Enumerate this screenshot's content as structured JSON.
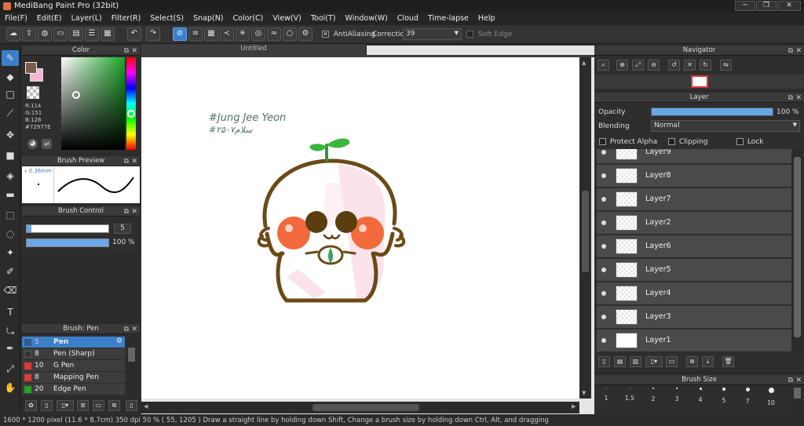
{
  "window": {
    "title": "MediBang Paint Pro (32bit)",
    "min": "─",
    "max": "❐",
    "close": "✕"
  },
  "menu": [
    "File(F)",
    "Edit(E)",
    "Layer(L)",
    "Filter(R)",
    "Select(S)",
    "Snap(N)",
    "Color(C)",
    "View(V)",
    "Tool(T)",
    "Window(W)",
    "Cloud",
    "Time-lapse",
    "Help"
  ],
  "toolbar": {
    "antialiasing_label": "AntiAliasing",
    "correction_label": "Correction",
    "correction_value": "39",
    "soft_edge_label": "Soft Edge"
  },
  "color_panel": {
    "title": "Color",
    "r": "R:114",
    "g": "G:151",
    "b": "B:126",
    "hex": "#72977E",
    "fg": "#7a5c4e",
    "bg": "#f2b8d0"
  },
  "brush_preview": {
    "title": "Brush Preview",
    "size": "0.36mm"
  },
  "brush_control": {
    "title": "Brush Control",
    "size_value": "5",
    "opacity_value": "100 %"
  },
  "brush_list": {
    "title": "Brush: Pen",
    "items": [
      {
        "size": "5",
        "name": "Pen",
        "color": "#2b5d8c",
        "selected": true
      },
      {
        "size": "8",
        "name": "Pen (Sharp)",
        "color": "#333333",
        "selected": false
      },
      {
        "size": "10",
        "name": "G Pen",
        "color": "#d93b3b",
        "selected": false
      },
      {
        "size": "8",
        "name": "Mapping Pen",
        "color": "#d93b3b",
        "selected": false
      },
      {
        "size": "20",
        "name": "Edge Pen",
        "color": "#2aa02a",
        "selected": false
      }
    ]
  },
  "document": {
    "tab": "Untitled",
    "sign_line1": "#Jung Jee Yeon",
    "sign_line2": "#سلام۲۵۰۷"
  },
  "navigator": {
    "title": "Navigator"
  },
  "layer_panel": {
    "title": "Layer",
    "opacity_label": "Opacity",
    "opacity_value": "100 %",
    "opacity": 1.0,
    "blending_label": "Blending",
    "blending_value": "Normal",
    "protect_alpha": "Protect Alpha",
    "clipping": "Clipping",
    "lock": "Lock",
    "layers": [
      "Layer9",
      "Layer8",
      "Layer7",
      "Layer2",
      "Layer6",
      "Layer5",
      "Layer4",
      "Layer3",
      "Layer1"
    ]
  },
  "brush_size": {
    "title": "Brush Size",
    "sizes": [
      "1",
      "1.5",
      "2",
      "3",
      "4",
      "5",
      "7",
      "10"
    ]
  },
  "status": {
    "text": "1600 * 1200 pixel   (11.6 * 8.7cm)  350 dpi   50 %   ( 55, 1205 )   Draw a straight line by holding down Shift, Change a brush size by holding down Ctrl, Alt, and dragging"
  }
}
